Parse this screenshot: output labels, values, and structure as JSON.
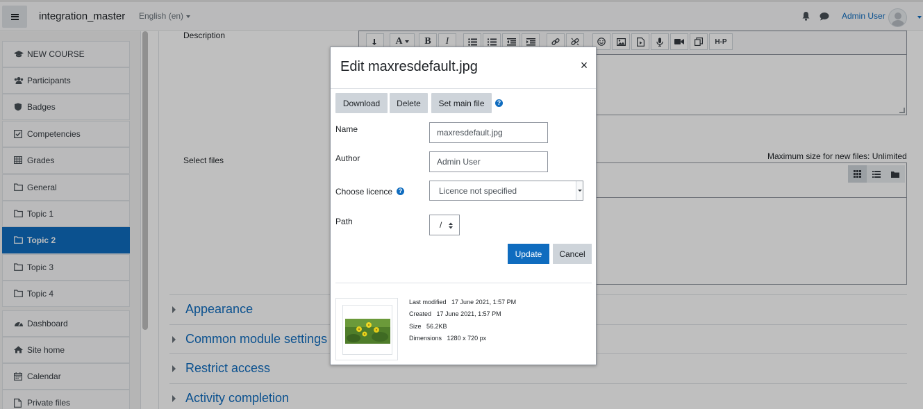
{
  "navbar": {
    "site_name": "integration_master",
    "language": "English (en)",
    "user_name": "Admin User"
  },
  "drawer": {
    "items": [
      {
        "label": "NEW COURSE",
        "icon": "graduation-cap-icon"
      },
      {
        "label": "Participants",
        "icon": "users-icon"
      },
      {
        "label": "Badges",
        "icon": "shield-icon"
      },
      {
        "label": "Competencies",
        "icon": "check-square-icon"
      },
      {
        "label": "Grades",
        "icon": "table-icon"
      },
      {
        "label": "General",
        "icon": "folder-icon"
      },
      {
        "label": "Topic 1",
        "icon": "folder-icon"
      },
      {
        "label": "Topic 2",
        "icon": "folder-icon",
        "active": true
      },
      {
        "label": "Topic 3",
        "icon": "folder-icon"
      },
      {
        "label": "Topic 4",
        "icon": "folder-icon"
      },
      {
        "label": "Dashboard",
        "icon": "dashboard-icon"
      },
      {
        "label": "Site home",
        "icon": "home-icon"
      },
      {
        "label": "Calendar",
        "icon": "calendar-icon"
      },
      {
        "label": "Private files",
        "icon": "file-icon"
      }
    ]
  },
  "form": {
    "description_label": "Description",
    "select_files_label": "Select files",
    "max_size_text": "Maximum size for new files: Unlimited",
    "editor_toolbar_h5p": "H-P",
    "sections": [
      "Appearance",
      "Common module settings",
      "Restrict access",
      "Activity completion"
    ]
  },
  "modal": {
    "title": "Edit maxresdefault.jpg",
    "close": "×",
    "buttons": {
      "download": "Download",
      "delete": "Delete",
      "set_main": "Set main file"
    },
    "help_glyph": "?",
    "name_label": "Name",
    "name_value": "maxresdefault.jpg",
    "author_label": "Author",
    "author_value": "Admin User",
    "licence_label": "Choose licence",
    "licence_value": "Licence not specified",
    "path_label": "Path",
    "path_value": "/",
    "update": "Update",
    "cancel": "Cancel",
    "meta": {
      "last_modified_label": "Last modified",
      "last_modified_value": "17 June 2021, 1:57 PM",
      "created_label": "Created",
      "created_value": "17 June 2021, 1:57 PM",
      "size_label": "Size",
      "size_value": "56.2KB",
      "dimensions_label": "Dimensions",
      "dimensions_value": "1280 x 720 px"
    }
  },
  "colors": {
    "brand": "#0f6cbf",
    "secondary_button": "#ced4da",
    "overlay": "#000000"
  }
}
